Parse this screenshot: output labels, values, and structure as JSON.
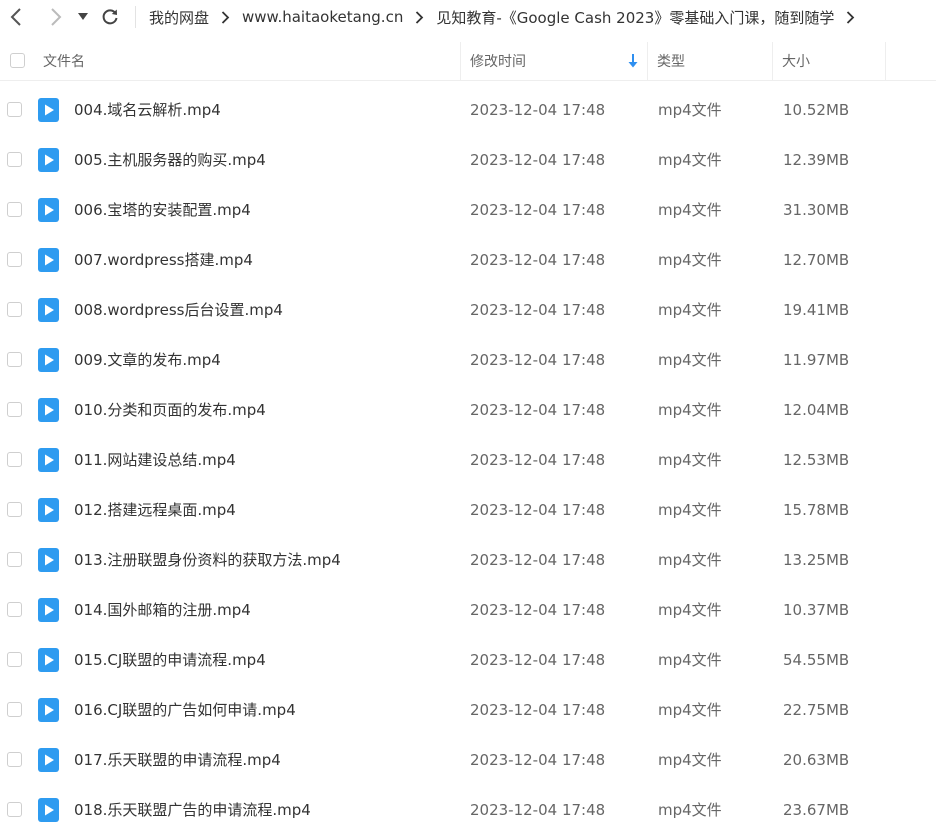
{
  "nav": {
    "breadcrumb": [
      "我的网盘",
      "www.haitaoketang.cn",
      "见知教育-《Google Cash 2023》零基础入门课，随到随学"
    ]
  },
  "columns": {
    "name": "文件名",
    "modified": "修改时间",
    "type": "类型",
    "size": "大小",
    "sort_column": "modified",
    "sort_direction": "descending"
  },
  "colors": {
    "accent": "#2e8ff0",
    "file_icon": "#2e9bf0",
    "text": "#333333",
    "muted": "#666666",
    "divider": "#eeeeee"
  },
  "files": [
    {
      "name": "004.域名云解析.mp4",
      "modified": "2023-12-04 17:48",
      "type": "mp4文件",
      "size": "10.52MB"
    },
    {
      "name": "005.主机服务器的购买.mp4",
      "modified": "2023-12-04 17:48",
      "type": "mp4文件",
      "size": "12.39MB"
    },
    {
      "name": "006.宝塔的安装配置.mp4",
      "modified": "2023-12-04 17:48",
      "type": "mp4文件",
      "size": "31.30MB"
    },
    {
      "name": "007.wordpress搭建.mp4",
      "modified": "2023-12-04 17:48",
      "type": "mp4文件",
      "size": "12.70MB"
    },
    {
      "name": "008.wordpress后台设置.mp4",
      "modified": "2023-12-04 17:48",
      "type": "mp4文件",
      "size": "19.41MB"
    },
    {
      "name": "009.文章的发布.mp4",
      "modified": "2023-12-04 17:48",
      "type": "mp4文件",
      "size": "11.97MB"
    },
    {
      "name": "010.分类和页面的发布.mp4",
      "modified": "2023-12-04 17:48",
      "type": "mp4文件",
      "size": "12.04MB"
    },
    {
      "name": "011.网站建设总结.mp4",
      "modified": "2023-12-04 17:48",
      "type": "mp4文件",
      "size": "12.53MB"
    },
    {
      "name": "012.搭建远程桌面.mp4",
      "modified": "2023-12-04 17:48",
      "type": "mp4文件",
      "size": "15.78MB"
    },
    {
      "name": "013.注册联盟身份资料的获取方法.mp4",
      "modified": "2023-12-04 17:48",
      "type": "mp4文件",
      "size": "13.25MB"
    },
    {
      "name": "014.国外邮箱的注册.mp4",
      "modified": "2023-12-04 17:48",
      "type": "mp4文件",
      "size": "10.37MB"
    },
    {
      "name": "015.CJ联盟的申请流程.mp4",
      "modified": "2023-12-04 17:48",
      "type": "mp4文件",
      "size": "54.55MB"
    },
    {
      "name": "016.CJ联盟的广告如何申请.mp4",
      "modified": "2023-12-04 17:48",
      "type": "mp4文件",
      "size": "22.75MB"
    },
    {
      "name": "017.乐天联盟的申请流程.mp4",
      "modified": "2023-12-04 17:48",
      "type": "mp4文件",
      "size": "20.63MB"
    },
    {
      "name": "018.乐天联盟广告的申请流程.mp4",
      "modified": "2023-12-04 17:48",
      "type": "mp4文件",
      "size": "23.67MB"
    }
  ]
}
